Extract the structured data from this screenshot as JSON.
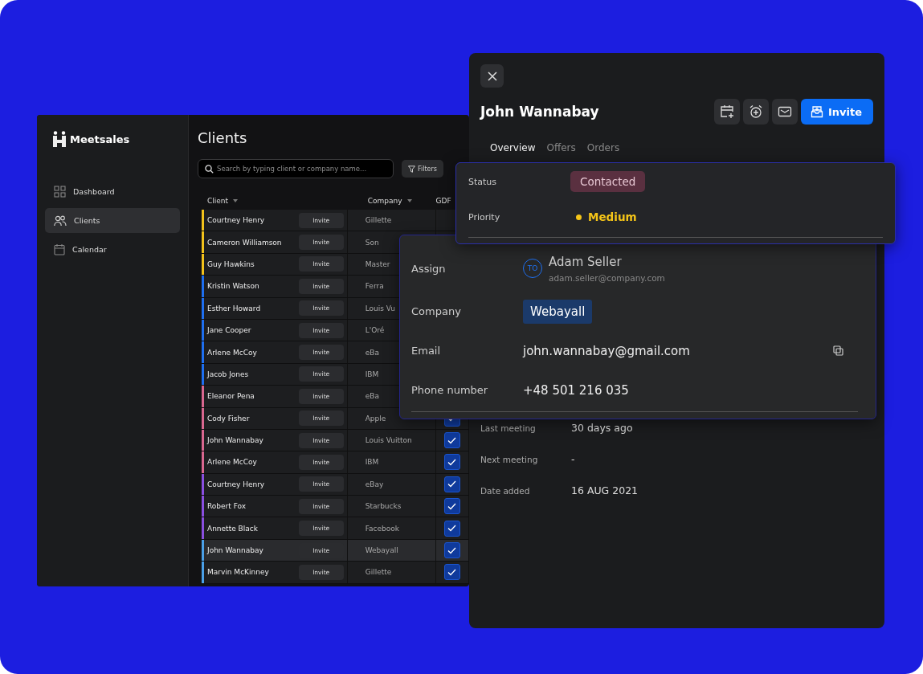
{
  "sidebar": {
    "logo": "Meetsales",
    "items": [
      {
        "label": "Dashboard",
        "kind": "grid",
        "selected": false
      },
      {
        "label": "Clients",
        "kind": "people",
        "selected": true
      },
      {
        "label": "Calendar",
        "kind": "calendar",
        "selected": false
      }
    ]
  },
  "clients": {
    "title": "Clients",
    "search": {
      "placeholder": "Search by typing client or company name..."
    },
    "filter_button": "Filters",
    "columns": [
      {
        "label": "Client",
        "sortable": true
      },
      {
        "label": "Company",
        "sortable": true
      },
      {
        "label": "GDF",
        "sortable": false
      }
    ],
    "rows": [
      {
        "client": "Courtney Henry",
        "action": "Invite",
        "company": "Gillette",
        "color": "#f2c21b",
        "selected": false
      },
      {
        "client": "Cameron Williamson",
        "action": "Invite",
        "company": "Son",
        "color": "#f2c21b",
        "selected": false
      },
      {
        "client": "Guy Hawkins",
        "action": "Invite",
        "company": "Master",
        "color": "#f2c21b",
        "selected": false
      },
      {
        "client": "Kristin Watson",
        "action": "Invite",
        "company": "Ferra",
        "color": "#1e6ff0",
        "selected": false
      },
      {
        "client": "Esther Howard",
        "action": "Invite",
        "company": "Louis Vu",
        "color": "#1e6ff0",
        "selected": false
      },
      {
        "client": "Jane Cooper",
        "action": "Invite",
        "company": "L'Oré",
        "color": "#1e6ff0",
        "selected": false
      },
      {
        "client": "Arlene McCoy",
        "action": "Invite",
        "company": "eBa",
        "color": "#1e6ff0",
        "selected": false
      },
      {
        "client": "Jacob Jones",
        "action": "Invite",
        "company": "IBM",
        "color": "#1e6ff0",
        "selected": false
      },
      {
        "client": "Eleanor Pena",
        "action": "Invite",
        "company": "eBa",
        "color": "#d9678f",
        "selected": false
      },
      {
        "client": "Cody Fisher",
        "action": "Invite",
        "company": "Apple",
        "color": "#d9678f",
        "selected": false,
        "gdpr_checked": true
      },
      {
        "client": "John Wannabay",
        "action": "Invite",
        "company": "Louis Vuitton",
        "color": "#d9678f",
        "selected": false,
        "gdpr_checked": true
      },
      {
        "client": "Arlene McCoy",
        "action": "Invite",
        "company": "IBM",
        "color": "#d9678f",
        "selected": false,
        "gdpr_checked": true
      },
      {
        "client": "Courtney Henry",
        "action": "Invite",
        "company": "eBay",
        "color": "#8a4fe0",
        "selected": false,
        "gdpr_checked": true
      },
      {
        "client": "Robert Fox",
        "action": "Invite",
        "company": "Starbucks",
        "color": "#8a4fe0",
        "selected": false,
        "gdpr_checked": true
      },
      {
        "client": "Annette Black",
        "action": "Invite",
        "company": "Facebook",
        "color": "#8a4fe0",
        "selected": false,
        "gdpr_checked": true
      },
      {
        "client": "John Wannabay",
        "action": "Invite",
        "company": "Webayall",
        "color": "#4aa0e8",
        "selected": true,
        "gdpr_checked": true
      },
      {
        "client": "Marvin McKinney",
        "action": "Invite",
        "company": "Gillette",
        "color": "#4aa0e8",
        "selected": false,
        "gdpr_checked": true
      }
    ]
  },
  "detail": {
    "name": "John Wannabay",
    "actions": [
      {
        "kind": "calendar-add"
      },
      {
        "kind": "alarm-add"
      },
      {
        "kind": "mail"
      }
    ],
    "invite_button": "Invite",
    "tabs": [
      {
        "label": "Overview",
        "selected": true
      },
      {
        "label": "Offers",
        "selected": false
      },
      {
        "label": "Orders",
        "selected": false
      }
    ],
    "fields": [
      {
        "label": "Last meeting",
        "value": "30 days ago"
      },
      {
        "label": "Next meeting",
        "value": "-"
      },
      {
        "label": "Date added",
        "value": "16 AUG 2021"
      }
    ]
  },
  "status_card": {
    "status": {
      "label": "Status",
      "value": "Contacted"
    },
    "priority": {
      "label": "Priority",
      "value": "Medium",
      "color": "#f5c518"
    }
  },
  "assign_card": {
    "assign": {
      "label": "Assign",
      "initials": "TO",
      "name": "Adam Seller",
      "email": "adam.seller@company.com"
    },
    "company": {
      "label": "Company",
      "value": "Webayall"
    },
    "email": {
      "label": "Email",
      "value": "john.wannabay@gmail.com"
    },
    "phone": {
      "label": "Phone number",
      "value": "+48 501 216 035"
    }
  }
}
